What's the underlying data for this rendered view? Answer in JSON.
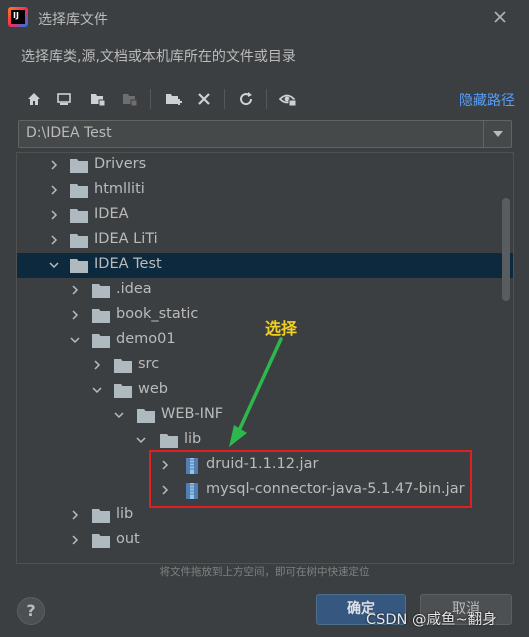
{
  "window": {
    "title": "选择库文件",
    "description": "选择库类,源,文档或本机库所在的文件或目录"
  },
  "toolbar": {
    "icons": [
      "home-icon",
      "desktop-icon",
      "project-icon",
      "module-icon",
      "new-folder-icon",
      "delete-icon",
      "refresh-icon",
      "show-hidden-icon"
    ],
    "hide_path_label": "隐藏路径"
  },
  "path_combo": {
    "value": "D:\\IDEA Test"
  },
  "tree": {
    "items": [
      {
        "label": "Drivers",
        "expanded": false,
        "type": "folder"
      },
      {
        "label": "htmlliti",
        "expanded": false,
        "type": "folder"
      },
      {
        "label": "IDEA",
        "expanded": false,
        "type": "folder"
      },
      {
        "label": "IDEA LiTi",
        "expanded": false,
        "type": "folder"
      },
      {
        "label": "IDEA Test",
        "expanded": true,
        "type": "folder",
        "selected": true
      },
      {
        "label": ".idea",
        "expanded": false,
        "type": "folder"
      },
      {
        "label": "book_static",
        "expanded": false,
        "type": "folder"
      },
      {
        "label": "demo01",
        "expanded": true,
        "type": "folder"
      },
      {
        "label": "src",
        "expanded": false,
        "type": "folder"
      },
      {
        "label": "web",
        "expanded": true,
        "type": "folder"
      },
      {
        "label": "WEB-INF",
        "expanded": true,
        "type": "folder"
      },
      {
        "label": "lib",
        "expanded": true,
        "type": "folder"
      },
      {
        "label": "druid-1.1.12.jar",
        "expanded": false,
        "type": "jar"
      },
      {
        "label": "mysql-connector-java-5.1.47-bin.jar",
        "expanded": false,
        "type": "jar"
      },
      {
        "label": "lib",
        "expanded": false,
        "type": "folder"
      },
      {
        "label": "out",
        "expanded": false,
        "type": "folder"
      }
    ]
  },
  "hint": "将文件拖放到上方空间，即可在树中快速定位",
  "buttons": {
    "help": "?",
    "ok": "确定",
    "cancel": "取消"
  },
  "annotation": {
    "label": "选择",
    "color": "#e02020",
    "arrow_color": "#2db84d"
  },
  "watermark": "CSDN @咸鱼~翻身",
  "colors": {
    "background": "#3c3f41",
    "selection": "#0d293e",
    "link": "#589df6",
    "primary_button": "#365880"
  }
}
